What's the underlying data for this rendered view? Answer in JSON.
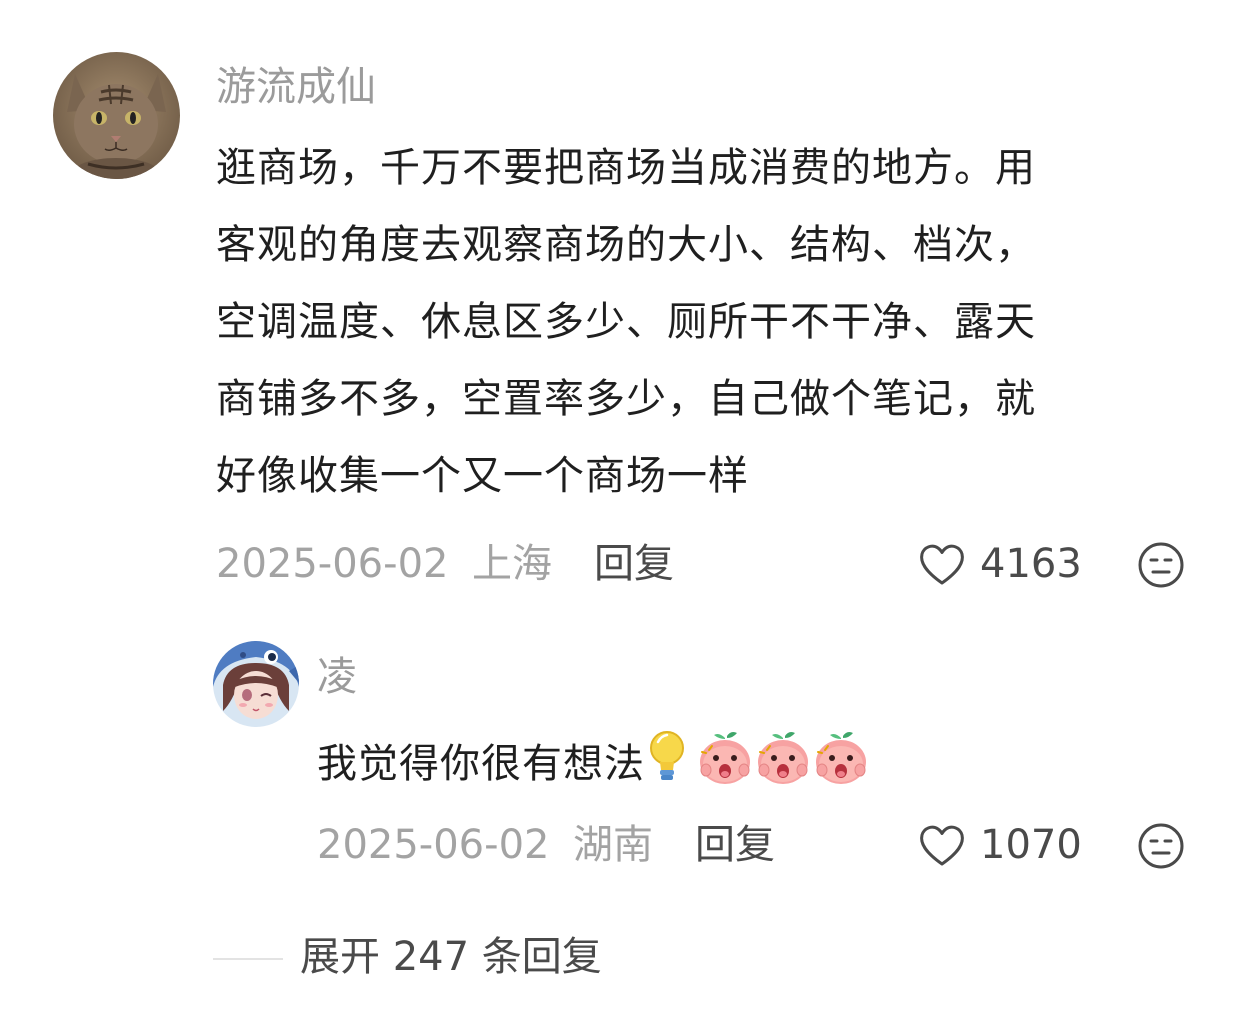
{
  "main_comment": {
    "username": "游流成仙",
    "text_lines": [
      "逛商场，千万不要把商场当成消费的地方。用",
      "客观的角度去观察商场的大小、结构、档次，",
      "空调温度、休息区多少、厕所干不干净、露天",
      "商铺多不多，空置率多少，自己做个笔记，就",
      "好像收集一个又一个商场一样"
    ],
    "date": "2025-06-02",
    "location": "上海",
    "reply_label": "回复",
    "likes": "4163",
    "icons": [
      "cat-avatar",
      "heart-outline-icon",
      "dislike-face-icon"
    ]
  },
  "reply_comment": {
    "username": "凌",
    "text": "我觉得你很有想法",
    "emojis": [
      "lightbulb-emoji",
      "peach-shocked-emoji",
      "peach-shocked-emoji",
      "peach-shocked-emoji"
    ],
    "date": "2025-06-02",
    "location": "湖南",
    "reply_label": "回复",
    "likes": "1070",
    "icons": [
      "anime-girl-avatar",
      "heart-outline-icon",
      "dislike-face-icon"
    ]
  },
  "expand": {
    "label": "展开 247 条回复"
  },
  "colors": {
    "text_primary": "#1f1f1f",
    "text_secondary": "#9b9b9b",
    "text_action": "#4a4a4a"
  }
}
